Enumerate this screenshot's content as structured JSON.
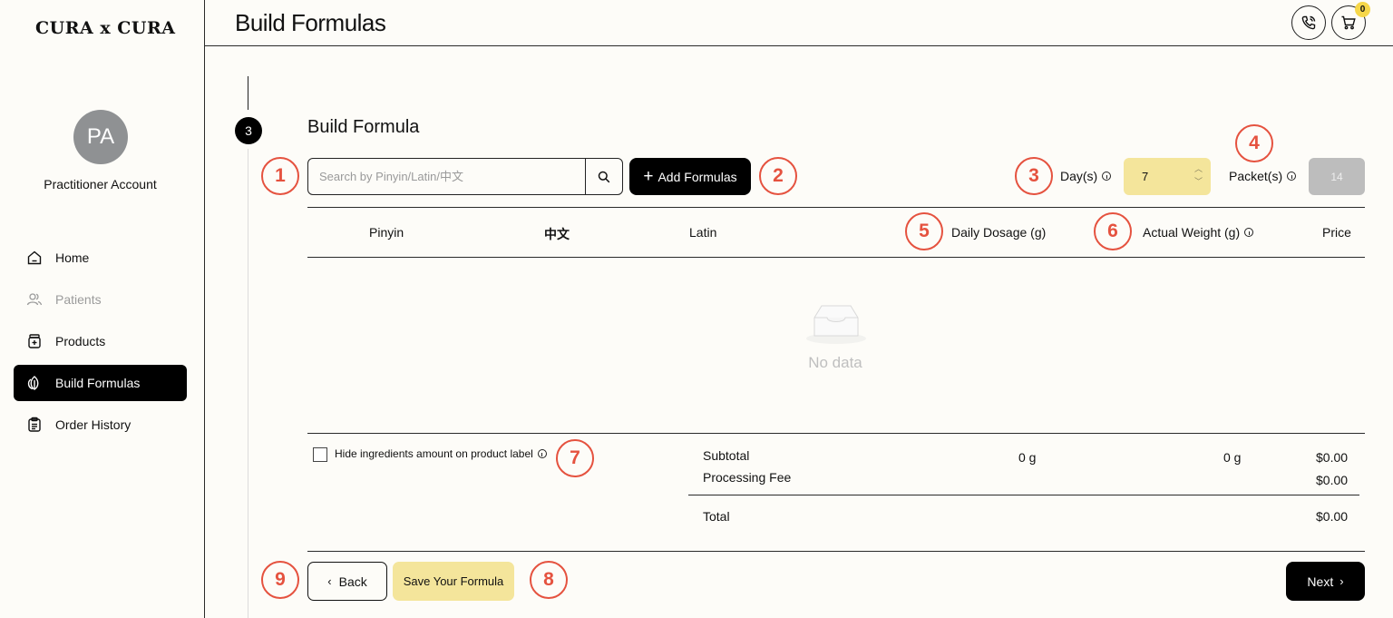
{
  "app": {
    "logo": "CURA x CURA"
  },
  "sidebar": {
    "avatar_initials": "PA",
    "account_name": "Practitioner Account",
    "items": [
      {
        "label": "Home",
        "icon": "home-icon",
        "state": "normal"
      },
      {
        "label": "Patients",
        "icon": "users-icon",
        "state": "disabled"
      },
      {
        "label": "Products",
        "icon": "product-jar-icon",
        "state": "normal"
      },
      {
        "label": "Build Formulas",
        "icon": "leaves-icon",
        "state": "active"
      },
      {
        "label": "Order History",
        "icon": "clipboard-icon",
        "state": "normal"
      }
    ]
  },
  "header": {
    "title": "Build Formulas",
    "cart_count": "0"
  },
  "step": {
    "number": "3",
    "title": "Build Formula"
  },
  "search": {
    "placeholder": "Search by Pinyin/Latin/中文",
    "value": ""
  },
  "toolbar": {
    "add_label": "Add Formulas",
    "days_label": "Day(s)",
    "days_value": "7",
    "packets_label": "Packet(s)",
    "packets_value": "14"
  },
  "table": {
    "columns": [
      "Pinyin",
      "中文",
      "Latin",
      "Daily Dosage (g)",
      "Actual Weight (g)",
      "Price"
    ],
    "rows": [],
    "empty_text": "No data"
  },
  "options": {
    "hide_label": "Hide ingredients amount on product label",
    "hide_checked": false
  },
  "summary": {
    "subtotal_label": "Subtotal",
    "subtotal_dosage": "0 g",
    "subtotal_weight": "0 g",
    "subtotal_price": "$0.00",
    "fee_label": "Processing Fee",
    "fee_price": "$0.00",
    "total_label": "Total",
    "total_price": "$0.00"
  },
  "footer": {
    "back_label": "Back",
    "save_label": "Save Your Formula",
    "next_label": "Next"
  },
  "annotations": [
    "1",
    "2",
    "3",
    "4",
    "5",
    "6",
    "7",
    "8",
    "9"
  ],
  "colors": {
    "background": "#fdfcf8",
    "accent_yellow": "#f4e59b",
    "badge_yellow": "#f6d74a",
    "annotation_red": "#e5523f",
    "primary": "#000000"
  }
}
